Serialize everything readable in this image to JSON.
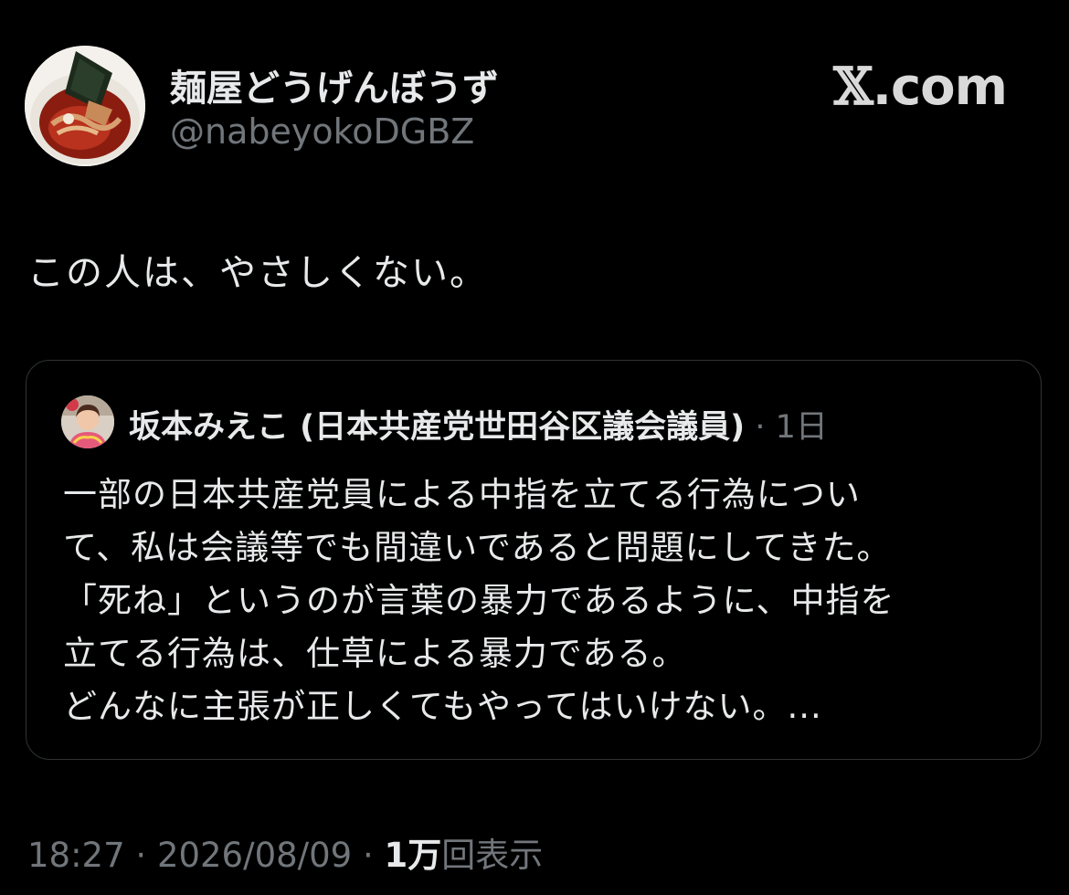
{
  "author": {
    "display_name": "麺屋どうげんぼうず",
    "handle": "@nabeyokoDGBZ",
    "avatar_icon": "ramen-bowl-avatar"
  },
  "brand": {
    "logo_text": "𝕏.com",
    "logo_mark": "𝕏",
    "logo_suffix": ".com"
  },
  "tweet": {
    "text": "この人は、やさしくない。"
  },
  "quoted_tweet": {
    "display_name": "坂本みえこ (日本共産党世田谷区議会議員)",
    "separator": " · ",
    "time": "1日",
    "lines": [
      "一部の日本共産党員による中指を立てる行為につい",
      "て、私は会議等でも間違いであると問題にしてきた。",
      "「死ね」というのが言葉の暴力であるように、中指を",
      "立てる行為は、仕草による暴力である。",
      "どんなに主張が正しくてもやってはいけない。..."
    ],
    "avatar_icon": "person-avatar"
  },
  "footer": {
    "time": "18:27",
    "sep1": " · ",
    "date": "2026/08/09",
    "sep2": " · ",
    "views_count": "1万",
    "views_label": "回表示"
  },
  "colors": {
    "background": "#000000",
    "text_primary": "#e7e9ea",
    "text_secondary": "#71767b",
    "border": "#2f3336"
  }
}
